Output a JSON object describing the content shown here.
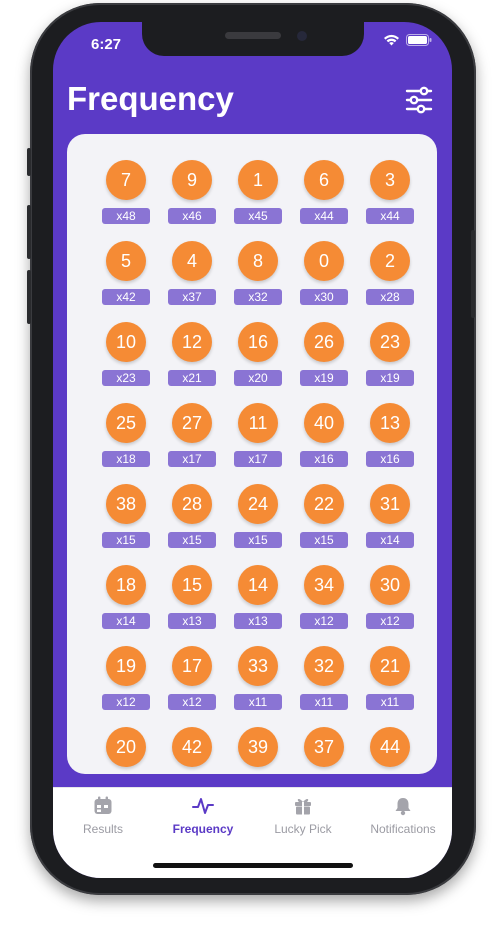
{
  "status": {
    "time": "6:27"
  },
  "header": {
    "title": "Frequency"
  },
  "numbers": [
    {
      "n": "7",
      "c": "x48"
    },
    {
      "n": "9",
      "c": "x46"
    },
    {
      "n": "1",
      "c": "x45"
    },
    {
      "n": "6",
      "c": "x44"
    },
    {
      "n": "3",
      "c": "x44"
    },
    {
      "n": "5",
      "c": "x42"
    },
    {
      "n": "4",
      "c": "x37"
    },
    {
      "n": "8",
      "c": "x32"
    },
    {
      "n": "0",
      "c": "x30"
    },
    {
      "n": "2",
      "c": "x28"
    },
    {
      "n": "10",
      "c": "x23"
    },
    {
      "n": "12",
      "c": "x21"
    },
    {
      "n": "16",
      "c": "x20"
    },
    {
      "n": "26",
      "c": "x19"
    },
    {
      "n": "23",
      "c": "x19"
    },
    {
      "n": "25",
      "c": "x18"
    },
    {
      "n": "27",
      "c": "x17"
    },
    {
      "n": "11",
      "c": "x17"
    },
    {
      "n": "40",
      "c": "x16"
    },
    {
      "n": "13",
      "c": "x16"
    },
    {
      "n": "38",
      "c": "x15"
    },
    {
      "n": "28",
      "c": "x15"
    },
    {
      "n": "24",
      "c": "x15"
    },
    {
      "n": "22",
      "c": "x15"
    },
    {
      "n": "31",
      "c": "x14"
    },
    {
      "n": "18",
      "c": "x14"
    },
    {
      "n": "15",
      "c": "x13"
    },
    {
      "n": "14",
      "c": "x13"
    },
    {
      "n": "34",
      "c": "x12"
    },
    {
      "n": "30",
      "c": "x12"
    },
    {
      "n": "19",
      "c": "x12"
    },
    {
      "n": "17",
      "c": "x12"
    },
    {
      "n": "33",
      "c": "x11"
    },
    {
      "n": "32",
      "c": "x11"
    },
    {
      "n": "21",
      "c": "x11"
    },
    {
      "n": "20",
      "c": ""
    },
    {
      "n": "42",
      "c": ""
    },
    {
      "n": "39",
      "c": ""
    },
    {
      "n": "37",
      "c": ""
    },
    {
      "n": "44",
      "c": ""
    }
  ],
  "tabs": [
    {
      "label": "Results",
      "icon": "calendar-icon"
    },
    {
      "label": "Frequency",
      "icon": "pulse-icon"
    },
    {
      "label": "Lucky Pick",
      "icon": "gift-icon"
    },
    {
      "label": "Notifications",
      "icon": "bell-icon"
    }
  ],
  "colors": {
    "accent": "#5b3ac6",
    "ball": "#f58b35",
    "badge": "#8a74d4"
  }
}
